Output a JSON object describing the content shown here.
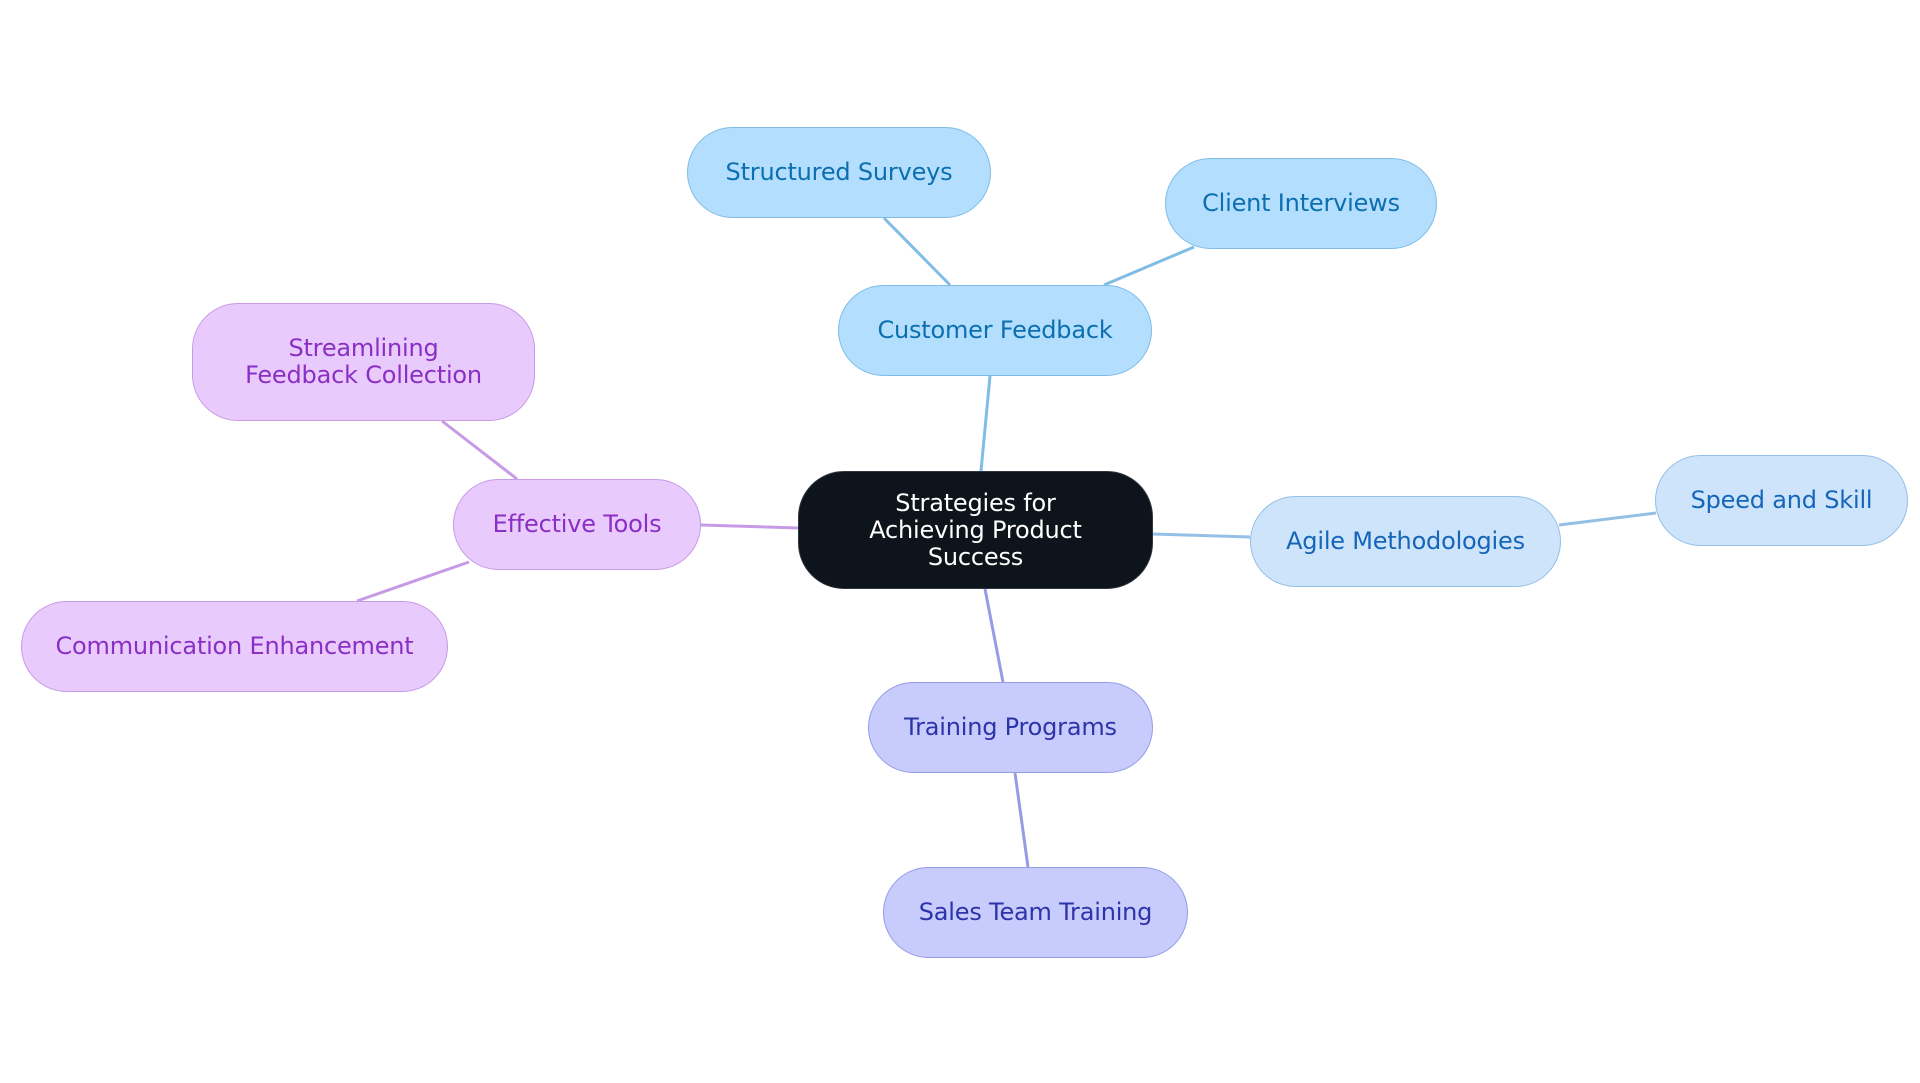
{
  "diagram": {
    "type": "mind-map",
    "root": {
      "id": "root",
      "label": "Strategies for Achieving Product Success"
    },
    "colors": {
      "root_fill": "#0d141b",
      "root_text": "#ffffff",
      "customer_feedback_branch": {
        "fill": "#b3defd",
        "stroke": "#7fbde6",
        "text": "#0b6fb0",
        "edge": "#7fbde6"
      },
      "agile_branch": {
        "fill": "#cde4fb",
        "stroke": "#94bfe6",
        "text": "#1565b8",
        "edge": "#94bfe6"
      },
      "training_branch": {
        "fill": "#c8ccfd",
        "stroke": "#959ce6",
        "text": "#2d33a8",
        "edge": "#959ce6"
      },
      "tools_branch": {
        "fill": "#e9cafd",
        "stroke": "#c79ae6",
        "text": "#8a2fc4",
        "edge": "#c79ae6"
      }
    },
    "nodes": {
      "customer_feedback": {
        "label": "Customer Feedback",
        "parent": "root"
      },
      "structured_surveys": {
        "label": "Structured Surveys",
        "parent": "customer_feedback"
      },
      "client_interviews": {
        "label": "Client Interviews",
        "parent": "customer_feedback"
      },
      "agile_methodologies": {
        "label": "Agile Methodologies",
        "parent": "root"
      },
      "speed_and_skill": {
        "label": "Speed and Skill",
        "parent": "agile_methodologies"
      },
      "training_programs": {
        "label": "Training Programs",
        "parent": "root"
      },
      "sales_team_training": {
        "label": "Sales Team Training",
        "parent": "training_programs"
      },
      "effective_tools": {
        "label": "Effective Tools",
        "parent": "root"
      },
      "streamlining_feedback": {
        "label": "Streamlining Feedback Collection",
        "parent": "effective_tools"
      },
      "communication_enhancement": {
        "label": "Communication Enhancement",
        "parent": "effective_tools"
      }
    },
    "edges": [
      {
        "from": "root",
        "to": "customer_feedback",
        "branch": "customer_feedback_branch"
      },
      {
        "from": "customer_feedback",
        "to": "structured_surveys",
        "branch": "customer_feedback_branch"
      },
      {
        "from": "customer_feedback",
        "to": "client_interviews",
        "branch": "customer_feedback_branch"
      },
      {
        "from": "root",
        "to": "agile_methodologies",
        "branch": "agile_branch"
      },
      {
        "from": "agile_methodologies",
        "to": "speed_and_skill",
        "branch": "agile_branch"
      },
      {
        "from": "root",
        "to": "training_programs",
        "branch": "training_branch"
      },
      {
        "from": "training_programs",
        "to": "sales_team_training",
        "branch": "training_branch"
      },
      {
        "from": "root",
        "to": "effective_tools",
        "branch": "tools_branch"
      },
      {
        "from": "effective_tools",
        "to": "streamlining_feedback",
        "branch": "tools_branch"
      },
      {
        "from": "effective_tools",
        "to": "communication_enhancement",
        "branch": "tools_branch"
      }
    ]
  }
}
